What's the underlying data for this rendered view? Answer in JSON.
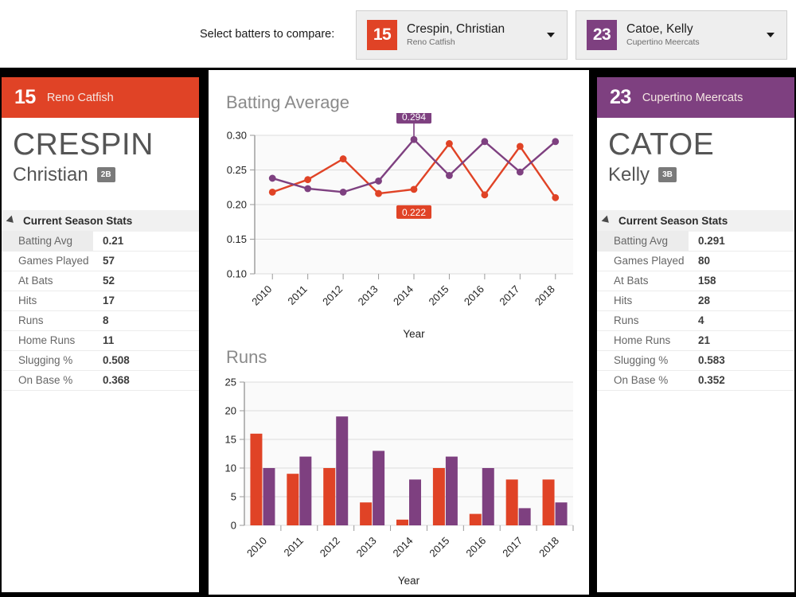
{
  "toolbar": {
    "label": "Select batters to compare:",
    "selectors": [
      {
        "number": "15",
        "name": "Crespin, Christian",
        "team": "Reno Catfish",
        "color": "#e04326",
        "caret": "chevron-down-icon"
      },
      {
        "number": "23",
        "name": "Catoe, Kelly",
        "team": "Cupertino Meercats",
        "color": "#7e4080",
        "caret": "chevron-down-icon"
      }
    ]
  },
  "players": [
    {
      "number": "15",
      "team": "Reno Catfish",
      "last_name": "CRESPIN",
      "first_name": "Christian",
      "position": "2B",
      "accent": "#e04326",
      "section_title": "Current Season Stats",
      "stats": [
        {
          "label": "Batting Avg",
          "value": "0.21"
        },
        {
          "label": "Games Played",
          "value": "57"
        },
        {
          "label": "At Bats",
          "value": "52"
        },
        {
          "label": "Hits",
          "value": "17"
        },
        {
          "label": "Runs",
          "value": "8"
        },
        {
          "label": "Home Runs",
          "value": "11"
        },
        {
          "label": "Slugging %",
          "value": "0.508"
        },
        {
          "label": "On Base %",
          "value": "0.368"
        }
      ]
    },
    {
      "number": "23",
      "team": "Cupertino Meercats",
      "last_name": "CATOE",
      "first_name": "Kelly",
      "position": "3B",
      "accent": "#7e4080",
      "section_title": "Current Season Stats",
      "stats": [
        {
          "label": "Batting Avg",
          "value": "0.291"
        },
        {
          "label": "Games Played",
          "value": "80"
        },
        {
          "label": "At Bats",
          "value": "158"
        },
        {
          "label": "Hits",
          "value": "28"
        },
        {
          "label": "Runs",
          "value": "4"
        },
        {
          "label": "Home Runs",
          "value": "21"
        },
        {
          "label": "Slugging %",
          "value": "0.583"
        },
        {
          "label": "On Base %",
          "value": "0.352"
        }
      ]
    }
  ],
  "chart_data": [
    {
      "type": "line",
      "title": "Batting Average",
      "xlabel": "Year",
      "ylabel": "",
      "categories": [
        "2010",
        "2011",
        "2012",
        "2013",
        "2014",
        "2015",
        "2016",
        "2017",
        "2018"
      ],
      "ylim": [
        0.1,
        0.3
      ],
      "yticks": [
        "0.10",
        "0.15",
        "0.20",
        "0.25",
        "0.30"
      ],
      "grid": true,
      "legend": "none",
      "series": [
        {
          "name": "Crespin, Christian",
          "color": "#e04326",
          "values": [
            0.218,
            0.236,
            0.266,
            0.216,
            0.222,
            0.288,
            0.214,
            0.284,
            0.21
          ]
        },
        {
          "name": "Catoe, Kelly",
          "color": "#7e4080",
          "values": [
            0.238,
            0.223,
            0.218,
            0.234,
            0.294,
            0.242,
            0.291,
            0.247,
            0.291
          ]
        }
      ],
      "annotations": [
        {
          "text": "0.294",
          "series": "Catoe, Kelly",
          "x": "2014",
          "value": 0.294,
          "color": "#7e4080"
        },
        {
          "text": "0.222",
          "series": "Crespin, Christian",
          "x": "2014",
          "value": 0.222,
          "color": "#e04326"
        }
      ]
    },
    {
      "type": "bar",
      "title": "Runs",
      "xlabel": "Year",
      "ylabel": "",
      "categories": [
        "2010",
        "2011",
        "2012",
        "2013",
        "2014",
        "2015",
        "2016",
        "2017",
        "2018"
      ],
      "ylim": [
        0,
        25
      ],
      "yticks": [
        "0",
        "5",
        "10",
        "15",
        "20",
        "25"
      ],
      "grid": true,
      "legend": "none",
      "series": [
        {
          "name": "Crespin, Christian",
          "color": "#e04326",
          "values": [
            16,
            9,
            10,
            4,
            1,
            10,
            2,
            8,
            8
          ]
        },
        {
          "name": "Catoe, Kelly",
          "color": "#7e4080",
          "values": [
            10,
            12,
            19,
            13,
            8,
            12,
            10,
            3,
            4
          ]
        }
      ]
    }
  ],
  "cursor": {
    "icon": "mouse-pointer-icon"
  }
}
